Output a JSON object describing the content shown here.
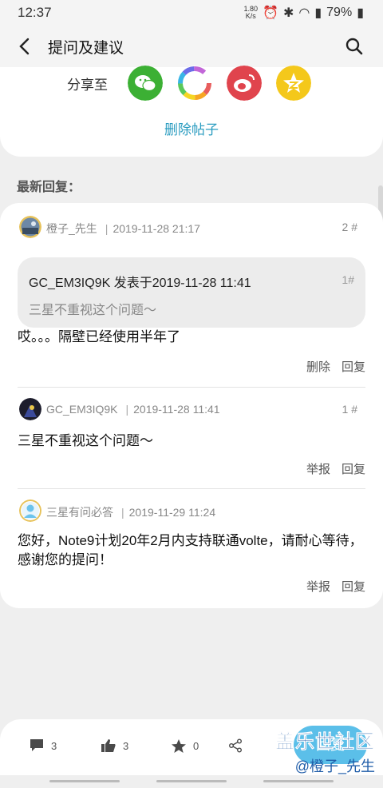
{
  "status": {
    "time": "12:37",
    "speed_top": "1.80",
    "speed_bottom": "K/s",
    "battery": "79%"
  },
  "appbar": {
    "title": "提问及建议"
  },
  "share": {
    "label": "分享至",
    "delete_label": "删除帖子"
  },
  "section": {
    "latest_replies": "最新回复："
  },
  "replies": [
    {
      "user": "橙子_先生",
      "time": "2019-11-28 21:17",
      "floor": "2 #",
      "quote": {
        "user_time": "GC_EM3IQ9K 发表于2019-11-28 11:41",
        "floor": "1#",
        "text": "三星不重视这个问题～"
      },
      "text": "哎。。。隔壁已经使用半年了",
      "actions": [
        "删除",
        "回复"
      ]
    },
    {
      "user": "GC_EM3IQ9K",
      "time": "2019-11-28 11:41",
      "floor": "1 #",
      "text": "三星不重视这个问题～",
      "actions": [
        "举报",
        "回复"
      ]
    },
    {
      "user": "三星有问必答",
      "time": "2019-11-29 11:24",
      "text": "您好，Note9计划20年2月内支持联通volte，请耐心等待，感谢您的提问！",
      "actions": [
        "举报",
        "回复"
      ]
    }
  ],
  "bottombar": {
    "comments": "3",
    "likes": "3",
    "favorites": "0",
    "reply_label": "回复"
  },
  "watermark": {
    "line1": "盖乐世社区",
    "line2": "@橙子_先生"
  },
  "colors": {
    "accent": "#2a9cc0",
    "wechat": "#3cb034",
    "weibo": "#e0444d",
    "qzone": "#f4c81b"
  }
}
